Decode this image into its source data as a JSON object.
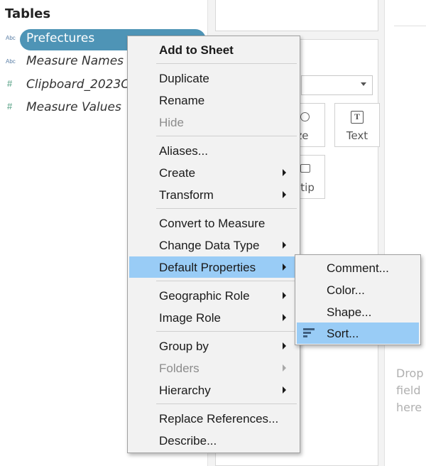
{
  "data_pane": {
    "title": "Tables",
    "fields": [
      {
        "type_icon": "Abc",
        "name": "Prefectures",
        "selected": true
      },
      {
        "type_icon": "Abc",
        "name": "Measure Names",
        "selected": false
      },
      {
        "type_icon": "#",
        "name": "Clipboard_2023C",
        "selected": false
      },
      {
        "type_icon": "#",
        "name": "Measure Values",
        "selected": false
      }
    ]
  },
  "marks": {
    "size_label_fragment": "ze",
    "text_label": "Text",
    "tooltip_label_fragment": "ltip"
  },
  "view": {
    "drop_hint": "Drop\nfield\nhere"
  },
  "context_menu": {
    "items": [
      {
        "label": "Add to Sheet",
        "bold": true
      },
      {
        "label": "Duplicate"
      },
      {
        "label": "Rename"
      },
      {
        "label": "Hide",
        "disabled": true
      },
      {
        "label": "Aliases..."
      },
      {
        "label": "Create",
        "submenu": true
      },
      {
        "label": "Transform",
        "submenu": true
      },
      {
        "label": "Convert to Measure"
      },
      {
        "label": "Change Data Type",
        "submenu": true
      },
      {
        "label": "Default Properties",
        "submenu": true,
        "highlighted": true
      },
      {
        "label": "Geographic Role",
        "submenu": true
      },
      {
        "label": "Image Role",
        "submenu": true
      },
      {
        "label": "Group by",
        "submenu": true
      },
      {
        "label": "Folders",
        "submenu": true,
        "disabled": true
      },
      {
        "label": "Hierarchy",
        "submenu": true
      },
      {
        "label": "Replace References..."
      },
      {
        "label": "Describe..."
      }
    ]
  },
  "submenu": {
    "items": [
      {
        "label": "Comment..."
      },
      {
        "label": "Color..."
      },
      {
        "label": "Shape..."
      },
      {
        "label": "Sort...",
        "highlighted": true,
        "icon": "sort-icon"
      }
    ]
  },
  "colors": {
    "selected_pill": "#4e94b6",
    "menu_highlight": "#99ccf6",
    "menu_background": "#f2f2f2"
  }
}
